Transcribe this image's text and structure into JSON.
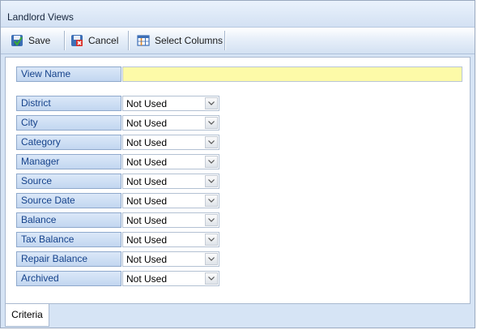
{
  "window": {
    "title": "Landlord Views"
  },
  "toolbar": {
    "save_label": "Save",
    "cancel_label": "Cancel",
    "select_columns_label": "Select Columns",
    "icons": {
      "save": "save-icon",
      "cancel": "cancel-icon",
      "select_columns": "columns-icon"
    }
  },
  "form": {
    "view_name": {
      "label": "View Name",
      "value": ""
    },
    "fields": [
      {
        "label": "District",
        "value": "Not Used"
      },
      {
        "label": "City",
        "value": "Not Used"
      },
      {
        "label": "Category",
        "value": "Not Used"
      },
      {
        "label": "Manager",
        "value": "Not Used"
      },
      {
        "label": "Source",
        "value": "Not Used"
      },
      {
        "label": "Source Date",
        "value": "Not Used"
      },
      {
        "label": "Balance",
        "value": "Not Used"
      },
      {
        "label": "Tax Balance",
        "value": "Not Used"
      },
      {
        "label": "Repair Balance",
        "value": "Not Used"
      },
      {
        "label": "Archived",
        "value": "Not Used"
      }
    ]
  },
  "tabs": [
    {
      "label": "Criteria",
      "active": true
    }
  ],
  "colors": {
    "label_bg": "#c8daf2",
    "label_text": "#15428b",
    "view_name_bg": "#fdfaa8",
    "toolbar_bg": "#dbe7f6"
  }
}
